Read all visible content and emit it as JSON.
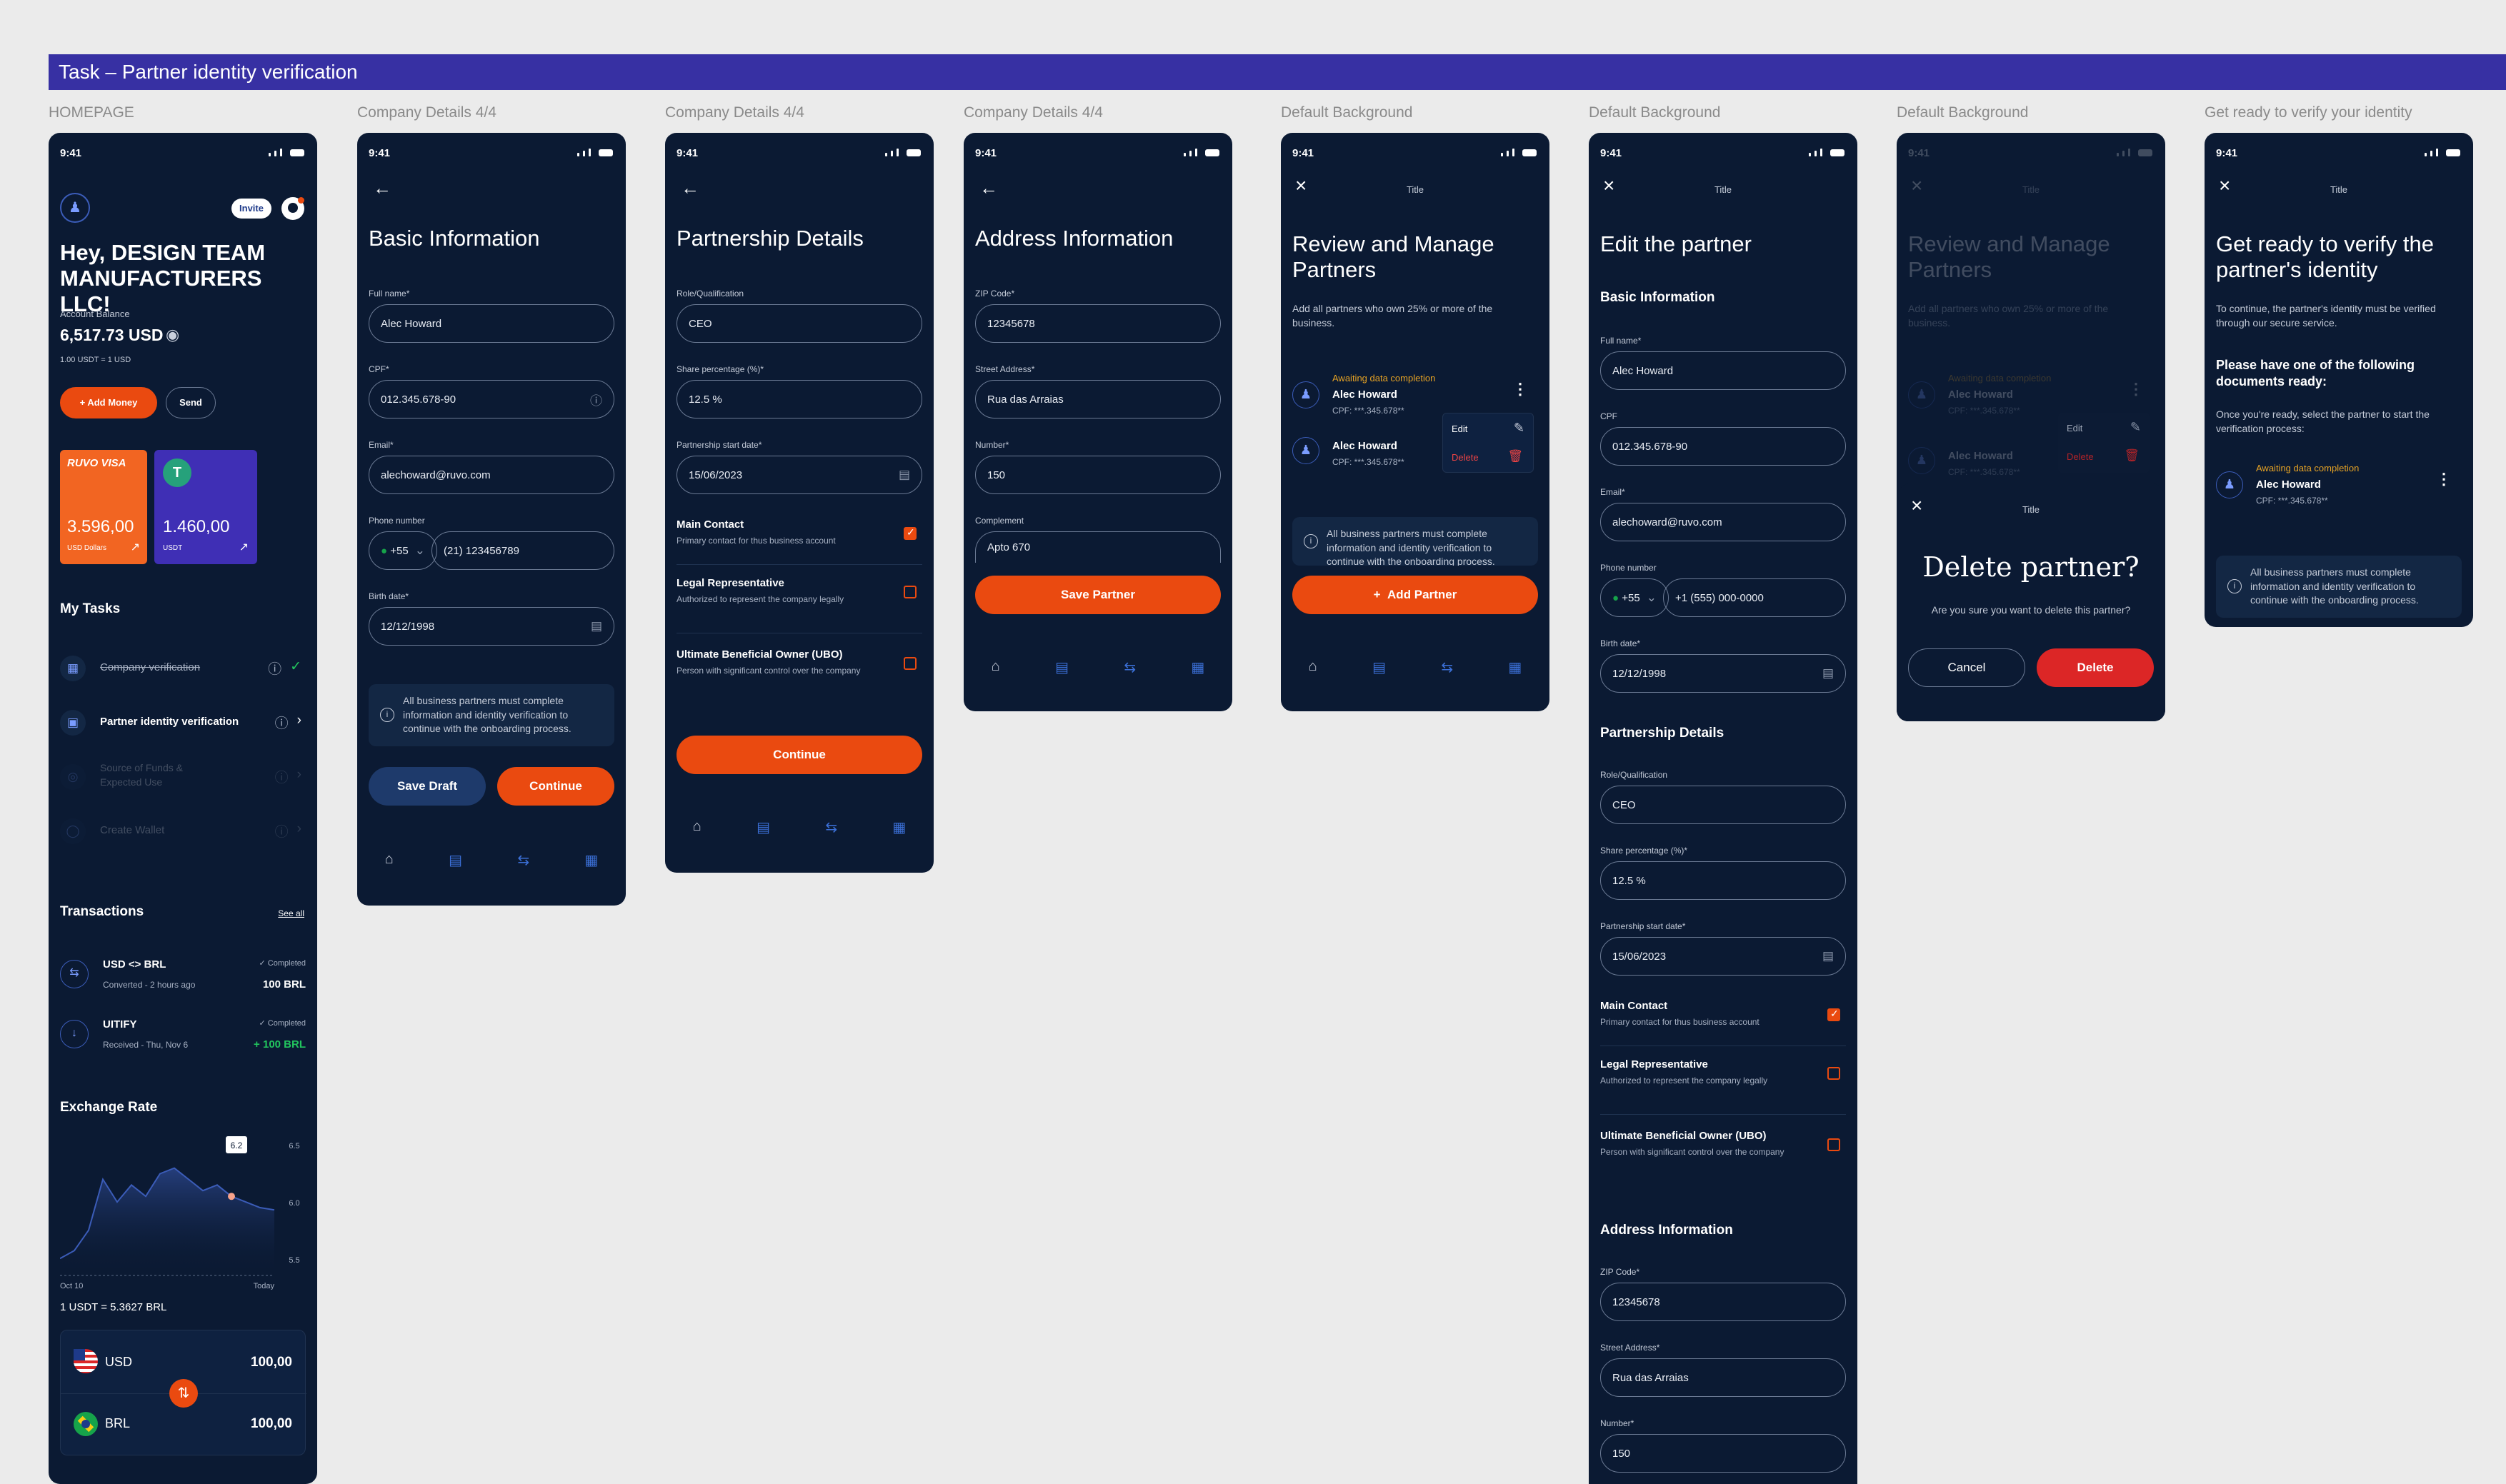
{
  "header": {
    "title": "Task – Partner identity verification"
  },
  "frame_labels": [
    "HOMEPAGE",
    "Company Details 4/4",
    "Company Details 4/4",
    "Company Details 4/4",
    "Default Background",
    "Default Background",
    "Default Background",
    "Get ready to verify your identity"
  ],
  "status_time": "9:41",
  "home": {
    "invite": "Invite",
    "greeting": "Hey, DESIGN TEAM MANUFACTURERS LLC!",
    "balance_label": "Account Balance",
    "balance": "6,517.73 USD",
    "rate": "1.00 USDT = 1 USD",
    "add_money": "Add Money",
    "send": "Send",
    "card1": {
      "brand": "RUVO VISA",
      "amount": "3.596,00",
      "currency": "USD Dollars"
    },
    "card2": {
      "amount": "1.460,00",
      "currency": "USDT"
    },
    "tasks_title": "My Tasks",
    "tasks": [
      "Company verification",
      "Partner identity verification",
      "Source of Funds & Expected Use",
      "Create Wallet"
    ],
    "transactions_title": "Transactions",
    "see_all": "See all",
    "transactions": [
      {
        "title": "USD <> BRL",
        "sub": "Converted - 2 hours ago",
        "status": "Completed",
        "amount": "100 BRL"
      },
      {
        "title": "UITIFY",
        "sub": "Received - Thu, Nov 6",
        "status": "Completed",
        "amount": "+ 100 BRL"
      }
    ],
    "exchange_title": "Exchange Rate",
    "chart_tooltip": "6.2",
    "chart_x": [
      "Oct 10",
      "Today"
    ],
    "chart_y": [
      "6.5",
      "6.0",
      "5.5"
    ],
    "exchange_rate_text": "1 USDT = 5.3627 BRL",
    "converter": [
      {
        "cur": "USD",
        "value": "100,00"
      },
      {
        "cur": "BRL",
        "value": "100,00"
      }
    ]
  },
  "chart_data": {
    "type": "area",
    "x": [
      "Oct 10",
      "",
      "",
      "",
      "",
      "",
      "",
      "",
      "",
      "",
      "",
      "",
      "",
      "",
      "",
      "Today"
    ],
    "values": [
      5.55,
      5.62,
      5.8,
      6.25,
      6.05,
      6.2,
      6.1,
      6.3,
      6.35,
      6.25,
      6.15,
      6.2,
      6.1,
      6.05,
      6.0,
      5.98
    ],
    "ylim": [
      5.4,
      6.6
    ],
    "annotation": "6.2"
  },
  "basic": {
    "title": "Basic Information",
    "fields": [
      {
        "label": "Full name*",
        "value": "Alec Howard"
      },
      {
        "label": "CPF*",
        "value": "012.345.678-90"
      },
      {
        "label": "Email*",
        "value": "alechoward@ruvo.com"
      },
      {
        "label": "Phone number",
        "prefix": "+55",
        "value": "(21) 123456789"
      },
      {
        "label": "Birth date*",
        "value": "12/12/1998"
      }
    ],
    "info": "All business partners must complete information and identity verification to continue with the onboarding process.",
    "save_draft": "Save Draft",
    "continue": "Continue"
  },
  "partnership": {
    "title": "Partnership Details",
    "fields": [
      {
        "label": "Role/Qualification",
        "value": "CEO"
      },
      {
        "label": "Share percentage (%)*",
        "value": "12.5 %"
      },
      {
        "label": "Partnership start date*",
        "value": "15/06/2023"
      }
    ],
    "checks": [
      {
        "title": "Main Contact",
        "desc": "Primary contact for thus business account",
        "checked": true
      },
      {
        "title": "Legal Representative",
        "desc": "Authorized to represent the company legally",
        "checked": false
      },
      {
        "title": "Ultimate Beneficial Owner (UBO)",
        "desc": "Person with significant control over the company",
        "checked": false
      }
    ],
    "continue": "Continue"
  },
  "address": {
    "title": "Address Information",
    "fields": [
      {
        "label": "ZIP Code*",
        "value": "12345678"
      },
      {
        "label": "Street Address*",
        "value": "Rua das Arraias"
      },
      {
        "label": "Number*",
        "value": "150"
      },
      {
        "label": "Complement",
        "value": "Apto 670"
      }
    ],
    "save": "Save Partner"
  },
  "review": {
    "nav_title": "Title",
    "title": "Review and Manage Partners",
    "desc": "Add all partners who own 25% or more of the business.",
    "status": "Awaiting data completion",
    "name": "Alec Howard",
    "cpf": "CPF: ***.345.678**",
    "menu_edit": "Edit",
    "menu_delete": "Delete",
    "info": "All business partners must complete information and identity verification to continue with the onboarding process.",
    "add": "Add Partner"
  },
  "edit": {
    "nav_title": "Title",
    "title": "Edit the partner",
    "basic_title": "Basic Information",
    "basic_fields": [
      {
        "label": "Full name*",
        "value": "Alec Howard"
      },
      {
        "label": "CPF",
        "value": "012.345.678-90"
      },
      {
        "label": "Email*",
        "value": "alechoward@ruvo.com"
      },
      {
        "label": "Phone number",
        "prefix": "+55",
        "value": "+1 (555) 000-0000"
      },
      {
        "label": "Birth date*",
        "value": "12/12/1998"
      }
    ],
    "partner_title": "Partnership Details",
    "partner_fields": [
      {
        "label": "Role/Qualification",
        "value": "CEO"
      },
      {
        "label": "Share percentage (%)*",
        "value": "12.5  %"
      },
      {
        "label": "Partnership start date*",
        "value": "15/06/2023"
      }
    ],
    "checks": [
      {
        "title": "Main Contact",
        "desc": "Primary contact for thus business account"
      },
      {
        "title": "Legal Representative",
        "desc": "Authorized to represent the company legally"
      },
      {
        "title": "Ultimate Beneficial Owner (UBO)",
        "desc": "Person with significant control over the company"
      }
    ],
    "address_title": "Address Information",
    "address_fields": [
      {
        "label": "ZIP Code*",
        "value": "12345678"
      },
      {
        "label": "Street Address*",
        "value": "Rua das Arraias"
      },
      {
        "label": "Number*",
        "value": "150"
      }
    ]
  },
  "delete_modal": {
    "nav_title": "Title",
    "title": "Delete partner?",
    "desc": "Are you sure you want to delete this partner?",
    "cancel": "Cancel",
    "delete": "Delete"
  },
  "ready": {
    "nav_title": "Title",
    "title": "Get ready to verify the partner's identity",
    "desc": "To continue, the partner's identity must be verified through our secure service.",
    "subtitle": "Please have one of the following documents ready:",
    "desc2": "Once you're ready, select the partner to start the verification process:",
    "status": "Awaiting data completion",
    "name": "Alec Howard",
    "cpf": "CPF: ***.345.678**",
    "info": "All business partners must complete information and identity verification to continue with the onboarding process."
  }
}
